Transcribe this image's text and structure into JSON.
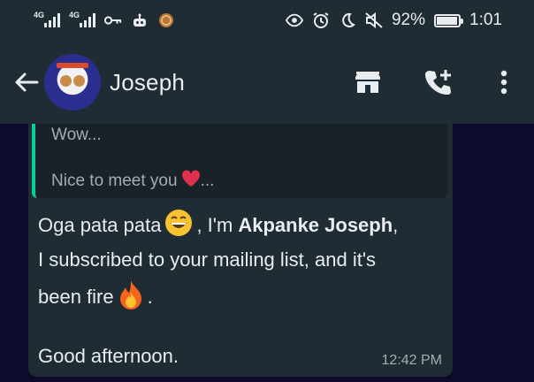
{
  "status_bar": {
    "net1_label": "4G",
    "net2_label": "4G",
    "battery_percent": "92%",
    "battery_level": 0.92,
    "clock": "1:01",
    "icons": [
      "signal-icon",
      "signal-icon",
      "key-icon",
      "robot-icon",
      "app-badge-icon",
      "eye-icon",
      "alarm-icon",
      "moon-icon",
      "mute-icon",
      "battery-icon"
    ]
  },
  "header": {
    "contact_name": "Joseph",
    "actions": [
      "store-icon",
      "add-call-icon",
      "more-vert-icon"
    ]
  },
  "message": {
    "quote": {
      "line1": "Wow...",
      "line2_text": "Nice to meet you",
      "line2_suffix": "...",
      "line2_emoji": "heart-emoji"
    },
    "text": {
      "l1_a": "Oga pata pata",
      "l1_b": ", I'm",
      "l1_bold": "Akpanke Joseph",
      "l1_c": ",",
      "l2": "I subscribed to your mailing list, and it's",
      "l3_a": "been fire",
      "l3_b": ".",
      "l4": "Good afternoon."
    },
    "time": "12:42 PM"
  },
  "colors": {
    "header_bg": "#1f2c33",
    "chat_bg": "#0c0b2e",
    "bubble_bg": "#1f2c33",
    "quote_bg": "#182228",
    "quote_accent": "#06cf9c",
    "text": "#e9edef",
    "muted": "#a4adb3"
  }
}
